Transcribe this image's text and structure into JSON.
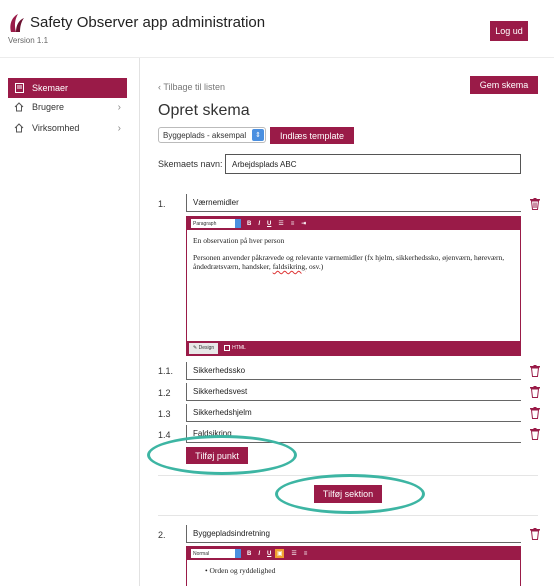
{
  "header": {
    "app_title": "Safety Observer app administration",
    "version": "Version 1.1",
    "logout_label": "Log ud"
  },
  "sidebar": {
    "items": [
      {
        "label": "Skemaer",
        "icon": "document-icon",
        "active": true
      },
      {
        "label": "Brugere",
        "icon": "home-icon",
        "active": false
      },
      {
        "label": "Virksomhed",
        "icon": "home-icon",
        "active": false
      }
    ]
  },
  "main": {
    "back_link": "‹ Tilbage til listen",
    "title": "Opret skema",
    "save_label": "Gem skema",
    "template_select": "Byggeplads - aksempal",
    "load_template_label": "Indlæs template",
    "name_label": "Skemaets navn:",
    "name_value": "Arbejdsplads ABC",
    "add_point_label": "Tilføj punkt",
    "add_section_label": "Tilføj sektion"
  },
  "sections": [
    {
      "number": "1.",
      "title": "Værnemidler",
      "editor": {
        "format": "Paragraph",
        "paragraph1": "En observation på hver person",
        "paragraph2_a": "Personen anvender påkrævede og relevante værnemidler (fx hjelm, sikkerhedssko, øjenværn, høreværn, åndedrætsværn, handsker, ",
        "paragraph2_spell": "faldsikring",
        "paragraph2_b": ", osv.)",
        "tab_design": "Design",
        "tab_html": "HTML"
      },
      "points": [
        {
          "number": "1.1.",
          "value": "Sikkerhedssko"
        },
        {
          "number": "1.2",
          "value": "Sikkerhedsvest"
        },
        {
          "number": "1.3",
          "value": "Sikkerhedshjelm"
        },
        {
          "number": "1.4",
          "value": "Faldsikring"
        }
      ]
    },
    {
      "number": "2.",
      "title": "Byggepladsindretning",
      "editor": {
        "format": "Normal",
        "bullet1": "Orden og ryddelighed"
      }
    }
  ],
  "colors": {
    "accent": "#9a1b48",
    "highlight": "#3db5a3",
    "select_blue": "#4a8fe0"
  }
}
